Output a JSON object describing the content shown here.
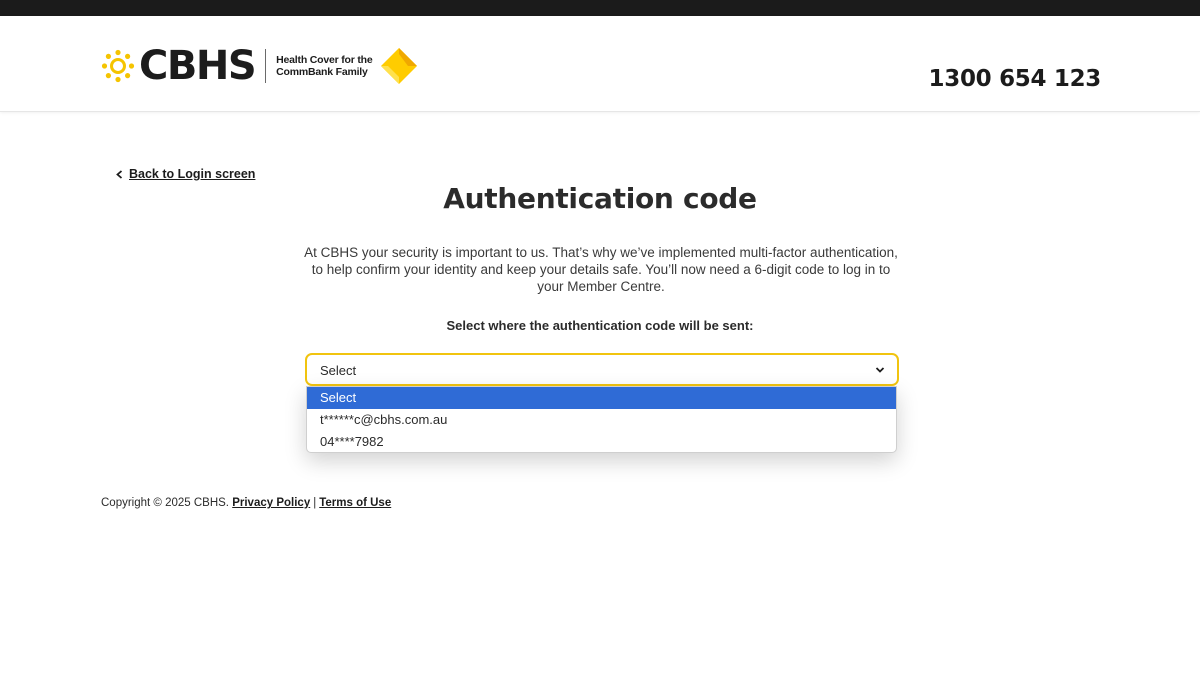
{
  "header": {
    "brand_name": "CBHS",
    "tagline_line1": "Health Cover for the",
    "tagline_line2": "CommBank Family",
    "phone": "1300 654 123"
  },
  "nav": {
    "back_label": "Back to Login screen"
  },
  "main": {
    "title": "Authentication code",
    "intro": "At CBHS your security is important to us. That’s why we’ve implemented multi-factor authentication, to help confirm your identity and keep your details safe. You’ll now need a 6-digit code to log in to your Member Centre.",
    "select_label": "Select where the authentication code will be sent:",
    "select": {
      "value": "Select",
      "options": [
        "Select",
        "t******c@cbhs.com.au",
        "04****7982"
      ],
      "highlighted_index": 0
    }
  },
  "footer": {
    "copyright": "Copyright © 2025 CBHS.",
    "privacy_label": "Privacy Policy",
    "separator": "|",
    "terms_label": "Terms of Use"
  },
  "colors": {
    "brand_yellow": "#f1c40f",
    "highlight_blue": "#2f6bd6",
    "top_bar": "#1b1b1b"
  }
}
